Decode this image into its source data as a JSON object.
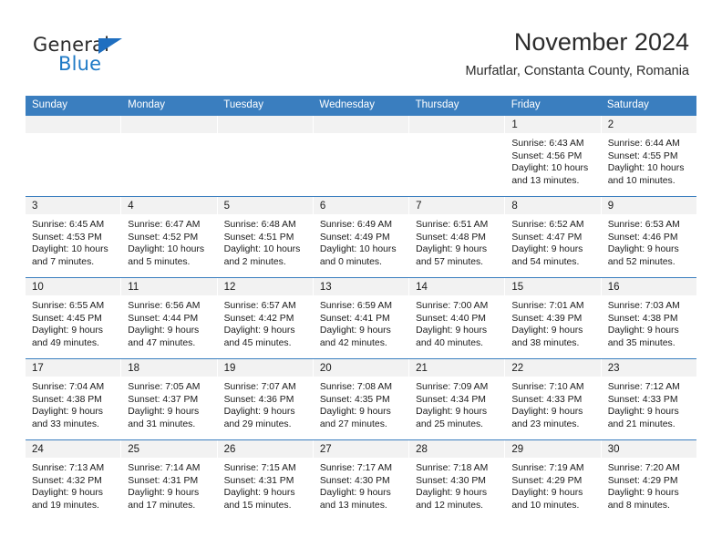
{
  "brand": {
    "name_part1": "General",
    "name_part2": "Blue",
    "triangle_color": "#1f6fc0",
    "blue_color": "#1f7ac6"
  },
  "header": {
    "title": "November 2024",
    "location": "Murfatlar, Constanta County, Romania"
  },
  "theme": {
    "header_blue": "#3a7ebf",
    "daynum_band": "#f2f2f2",
    "text": "#1a1a1a"
  },
  "weekdays": [
    "Sunday",
    "Monday",
    "Tuesday",
    "Wednesday",
    "Thursday",
    "Friday",
    "Saturday"
  ],
  "weeks": [
    [
      {
        "day": "",
        "sunrise": "",
        "sunset": "",
        "daylight1": "",
        "daylight2": ""
      },
      {
        "day": "",
        "sunrise": "",
        "sunset": "",
        "daylight1": "",
        "daylight2": ""
      },
      {
        "day": "",
        "sunrise": "",
        "sunset": "",
        "daylight1": "",
        "daylight2": ""
      },
      {
        "day": "",
        "sunrise": "",
        "sunset": "",
        "daylight1": "",
        "daylight2": ""
      },
      {
        "day": "",
        "sunrise": "",
        "sunset": "",
        "daylight1": "",
        "daylight2": ""
      },
      {
        "day": "1",
        "sunrise": "Sunrise: 6:43 AM",
        "sunset": "Sunset: 4:56 PM",
        "daylight1": "Daylight: 10 hours",
        "daylight2": "and 13 minutes."
      },
      {
        "day": "2",
        "sunrise": "Sunrise: 6:44 AM",
        "sunset": "Sunset: 4:55 PM",
        "daylight1": "Daylight: 10 hours",
        "daylight2": "and 10 minutes."
      }
    ],
    [
      {
        "day": "3",
        "sunrise": "Sunrise: 6:45 AM",
        "sunset": "Sunset: 4:53 PM",
        "daylight1": "Daylight: 10 hours",
        "daylight2": "and 7 minutes."
      },
      {
        "day": "4",
        "sunrise": "Sunrise: 6:47 AM",
        "sunset": "Sunset: 4:52 PM",
        "daylight1": "Daylight: 10 hours",
        "daylight2": "and 5 minutes."
      },
      {
        "day": "5",
        "sunrise": "Sunrise: 6:48 AM",
        "sunset": "Sunset: 4:51 PM",
        "daylight1": "Daylight: 10 hours",
        "daylight2": "and 2 minutes."
      },
      {
        "day": "6",
        "sunrise": "Sunrise: 6:49 AM",
        "sunset": "Sunset: 4:49 PM",
        "daylight1": "Daylight: 10 hours",
        "daylight2": "and 0 minutes."
      },
      {
        "day": "7",
        "sunrise": "Sunrise: 6:51 AM",
        "sunset": "Sunset: 4:48 PM",
        "daylight1": "Daylight: 9 hours",
        "daylight2": "and 57 minutes."
      },
      {
        "day": "8",
        "sunrise": "Sunrise: 6:52 AM",
        "sunset": "Sunset: 4:47 PM",
        "daylight1": "Daylight: 9 hours",
        "daylight2": "and 54 minutes."
      },
      {
        "day": "9",
        "sunrise": "Sunrise: 6:53 AM",
        "sunset": "Sunset: 4:46 PM",
        "daylight1": "Daylight: 9 hours",
        "daylight2": "and 52 minutes."
      }
    ],
    [
      {
        "day": "10",
        "sunrise": "Sunrise: 6:55 AM",
        "sunset": "Sunset: 4:45 PM",
        "daylight1": "Daylight: 9 hours",
        "daylight2": "and 49 minutes."
      },
      {
        "day": "11",
        "sunrise": "Sunrise: 6:56 AM",
        "sunset": "Sunset: 4:44 PM",
        "daylight1": "Daylight: 9 hours",
        "daylight2": "and 47 minutes."
      },
      {
        "day": "12",
        "sunrise": "Sunrise: 6:57 AM",
        "sunset": "Sunset: 4:42 PM",
        "daylight1": "Daylight: 9 hours",
        "daylight2": "and 45 minutes."
      },
      {
        "day": "13",
        "sunrise": "Sunrise: 6:59 AM",
        "sunset": "Sunset: 4:41 PM",
        "daylight1": "Daylight: 9 hours",
        "daylight2": "and 42 minutes."
      },
      {
        "day": "14",
        "sunrise": "Sunrise: 7:00 AM",
        "sunset": "Sunset: 4:40 PM",
        "daylight1": "Daylight: 9 hours",
        "daylight2": "and 40 minutes."
      },
      {
        "day": "15",
        "sunrise": "Sunrise: 7:01 AM",
        "sunset": "Sunset: 4:39 PM",
        "daylight1": "Daylight: 9 hours",
        "daylight2": "and 38 minutes."
      },
      {
        "day": "16",
        "sunrise": "Sunrise: 7:03 AM",
        "sunset": "Sunset: 4:38 PM",
        "daylight1": "Daylight: 9 hours",
        "daylight2": "and 35 minutes."
      }
    ],
    [
      {
        "day": "17",
        "sunrise": "Sunrise: 7:04 AM",
        "sunset": "Sunset: 4:38 PM",
        "daylight1": "Daylight: 9 hours",
        "daylight2": "and 33 minutes."
      },
      {
        "day": "18",
        "sunrise": "Sunrise: 7:05 AM",
        "sunset": "Sunset: 4:37 PM",
        "daylight1": "Daylight: 9 hours",
        "daylight2": "and 31 minutes."
      },
      {
        "day": "19",
        "sunrise": "Sunrise: 7:07 AM",
        "sunset": "Sunset: 4:36 PM",
        "daylight1": "Daylight: 9 hours",
        "daylight2": "and 29 minutes."
      },
      {
        "day": "20",
        "sunrise": "Sunrise: 7:08 AM",
        "sunset": "Sunset: 4:35 PM",
        "daylight1": "Daylight: 9 hours",
        "daylight2": "and 27 minutes."
      },
      {
        "day": "21",
        "sunrise": "Sunrise: 7:09 AM",
        "sunset": "Sunset: 4:34 PM",
        "daylight1": "Daylight: 9 hours",
        "daylight2": "and 25 minutes."
      },
      {
        "day": "22",
        "sunrise": "Sunrise: 7:10 AM",
        "sunset": "Sunset: 4:33 PM",
        "daylight1": "Daylight: 9 hours",
        "daylight2": "and 23 minutes."
      },
      {
        "day": "23",
        "sunrise": "Sunrise: 7:12 AM",
        "sunset": "Sunset: 4:33 PM",
        "daylight1": "Daylight: 9 hours",
        "daylight2": "and 21 minutes."
      }
    ],
    [
      {
        "day": "24",
        "sunrise": "Sunrise: 7:13 AM",
        "sunset": "Sunset: 4:32 PM",
        "daylight1": "Daylight: 9 hours",
        "daylight2": "and 19 minutes."
      },
      {
        "day": "25",
        "sunrise": "Sunrise: 7:14 AM",
        "sunset": "Sunset: 4:31 PM",
        "daylight1": "Daylight: 9 hours",
        "daylight2": "and 17 minutes."
      },
      {
        "day": "26",
        "sunrise": "Sunrise: 7:15 AM",
        "sunset": "Sunset: 4:31 PM",
        "daylight1": "Daylight: 9 hours",
        "daylight2": "and 15 minutes."
      },
      {
        "day": "27",
        "sunrise": "Sunrise: 7:17 AM",
        "sunset": "Sunset: 4:30 PM",
        "daylight1": "Daylight: 9 hours",
        "daylight2": "and 13 minutes."
      },
      {
        "day": "28",
        "sunrise": "Sunrise: 7:18 AM",
        "sunset": "Sunset: 4:30 PM",
        "daylight1": "Daylight: 9 hours",
        "daylight2": "and 12 minutes."
      },
      {
        "day": "29",
        "sunrise": "Sunrise: 7:19 AM",
        "sunset": "Sunset: 4:29 PM",
        "daylight1": "Daylight: 9 hours",
        "daylight2": "and 10 minutes."
      },
      {
        "day": "30",
        "sunrise": "Sunrise: 7:20 AM",
        "sunset": "Sunset: 4:29 PM",
        "daylight1": "Daylight: 9 hours",
        "daylight2": "and 8 minutes."
      }
    ]
  ]
}
